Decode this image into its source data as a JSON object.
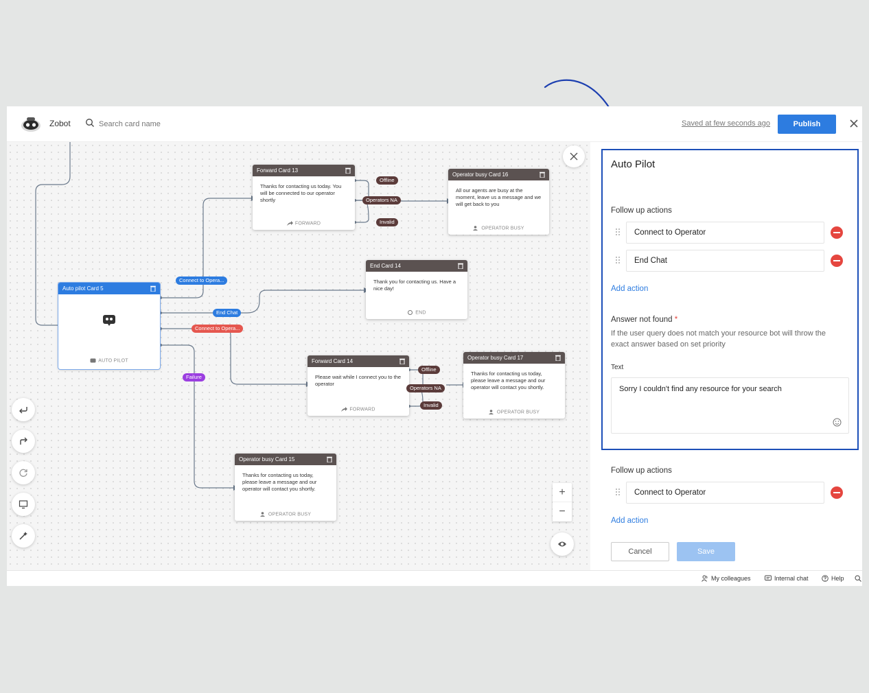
{
  "header": {
    "app_name": "Zobot",
    "search_placeholder": "Search card name",
    "saved_text": "Saved at few seconds ago",
    "publish_label": "Publish"
  },
  "canvas": {
    "cards": {
      "forward13": {
        "title": "Forward Card 13",
        "body": "Thanks for contacting us today. You will be connected to our operator shortly",
        "footer": "FORWARD"
      },
      "busy16": {
        "title": "Operator busy Card 16",
        "body": "All our agents are busy at the moment, leave us a message and we will get back to you",
        "footer": "OPERATOR BUSY"
      },
      "end14": {
        "title": "End Card 14",
        "body": "Thank you for contacting us. Have a nice day!",
        "footer": "END"
      },
      "autopilot5": {
        "title": "Auto pilot Card 5",
        "footer": "AUTO PILOT"
      },
      "forward14": {
        "title": "Forward Card 14",
        "body": "Please wait while I connect you to the operator",
        "footer": "FORWARD"
      },
      "busy17": {
        "title": "Operator busy Card 17",
        "body": "Thanks for contacting us today, please leave a message and our operator will contact you shortly.",
        "footer": "OPERATOR BUSY"
      },
      "busy15": {
        "title": "Operator busy Card 15",
        "body": "Thanks for contacting us today, please leave a message and our operator will contact you shortly.",
        "footer": "OPERATOR BUSY"
      }
    },
    "pills": {
      "offline_a": "Offline",
      "operators_na_a": "Operators NA",
      "invalid_a": "Invalid",
      "connect_blue": "Connect to Opera...",
      "end_chat": "End Chat",
      "connect_red": "Connect to Opera...",
      "failure": "Failure",
      "offline_b": "Offline",
      "operators_na_b": "Operators NA",
      "invalid_b": "Invalid"
    },
    "zoom_in": "+",
    "zoom_out": "−"
  },
  "panel": {
    "title": "Auto Pilot",
    "follow_up_label": "Follow up actions",
    "actions": [
      "Connect to Operator",
      "End Chat"
    ],
    "add_action": "Add action",
    "answer_not_found_label": "Answer not found",
    "required_mark": "*",
    "answer_desc": "If the user query does not match your resource bot will throw the exact answer based on set priority",
    "text_label": "Text",
    "text_value": "Sorry I couldn't find any resource for your search",
    "follow_up_label_2": "Follow up actions",
    "actions_2": [
      "Connect to Operator"
    ],
    "add_action_2": "Add action",
    "cancel_label": "Cancel",
    "save_label": "Save"
  },
  "footer": {
    "colleagues": "My colleagues",
    "internal_chat": "Internal chat",
    "help": "Help"
  },
  "colors": {
    "accent": "#2d7ce0",
    "card_header": "#5b5251",
    "danger": "#e5463f",
    "failure_pill": "#9b3ee0",
    "annotation_arrow": "#1c3fb0"
  }
}
